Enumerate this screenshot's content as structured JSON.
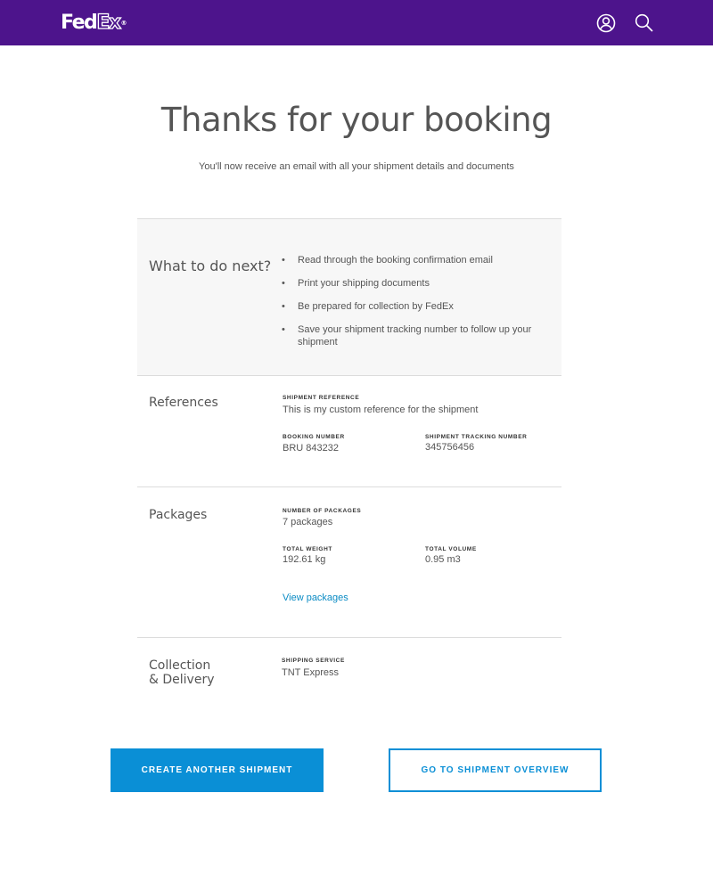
{
  "header": {
    "logo_fed": "Fed",
    "logo_ex": "Ex",
    "logo_reg": "®",
    "bg_color": "#4d148c",
    "icons": [
      "user-icon",
      "search-icon"
    ]
  },
  "confirmation": {
    "title": "Thanks for your booking",
    "subtitle": "You'll now receive an email with all your shipment details and documents"
  },
  "next_steps": {
    "title": "What to do next?",
    "items": [
      "Read through the booking confirmation email",
      "Print your shipping documents",
      "Be prepared for collection by FedEx",
      "Save your shipment tracking number to follow up your shipment"
    ]
  },
  "references": {
    "title": "References",
    "shipment_reference_label": "SHIPMENT REFERENCE",
    "shipment_reference_value": "This is my custom reference for the shipment",
    "booking_number_label": "BOOKING NUMBER",
    "booking_number_value": "BRU 843232",
    "tracking_number_label": "SHIPMENT TRACKING NUMBER",
    "tracking_number_value": "345756456"
  },
  "packages": {
    "title": "Packages",
    "number_label": "NUMBER OF PACKAGES",
    "number_value": "7 packages",
    "weight_label": "TOTAL WEIGHT",
    "weight_value": "192.61 kg",
    "volume_label": "TOTAL VOLUME",
    "volume_value": "0.95 m3",
    "view_link": "View packages"
  },
  "collection": {
    "title_line1": "Collection",
    "title_line2": "& Delivery",
    "service_label": "SHIPPING SERVICE",
    "service_value": "TNT Express"
  },
  "actions": {
    "primary_label": "CREATE ANOTHER SHIPMENT",
    "secondary_label": "GO TO SHIPMENT OVERVIEW",
    "accent_color": "#0a8fd6"
  }
}
